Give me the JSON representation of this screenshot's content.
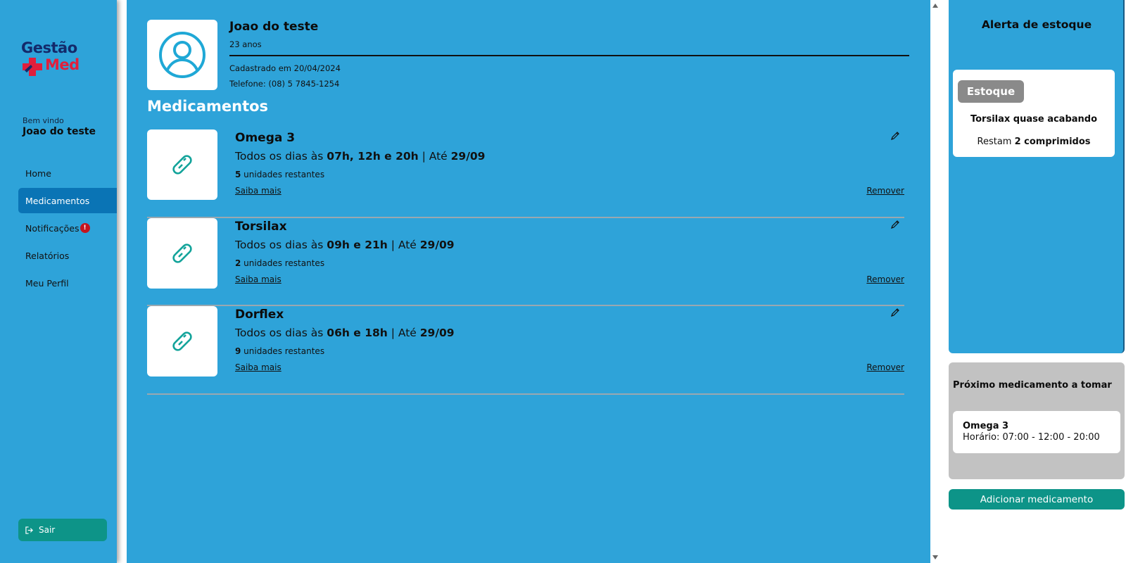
{
  "sidebar": {
    "logo": {
      "line1": "Gestão",
      "line2": "Med"
    },
    "welcome_label": "Bem vindo",
    "user_name": "Joao do teste",
    "nav": [
      {
        "label": "Home",
        "active": false
      },
      {
        "label": "Medicamentos",
        "active": true
      },
      {
        "label": "Notificações",
        "active": false,
        "badge": "!"
      },
      {
        "label": "Relatórios",
        "active": false
      },
      {
        "label": "Meu Perfil",
        "active": false
      }
    ],
    "logout_label": "Sair"
  },
  "profile": {
    "name": "Joao do teste",
    "age": "23 anos",
    "registered": "Cadastrado em 20/04/2024",
    "phone": "Telefone: (08) 5 7845-1254"
  },
  "section_title": "Medicamentos",
  "medications": [
    {
      "name": "Omega 3",
      "sched_prefix": "Todos os dias às ",
      "times": "07h, 12h e 20h",
      "until_prefix": " | Até ",
      "until": "29/09",
      "units": "5",
      "units_suffix": " unidades restantes",
      "more": "Saiba mais",
      "remove": "Remover"
    },
    {
      "name": "Torsilax",
      "sched_prefix": "Todos os dias às ",
      "times": "09h e 21h",
      "until_prefix": " | Até ",
      "until": "29/09",
      "units": "2",
      "units_suffix": " unidades restantes",
      "more": "Saiba mais",
      "remove": "Remover"
    },
    {
      "name": "Dorflex",
      "sched_prefix": "Todos os dias às ",
      "times": "06h e 18h",
      "until_prefix": " | Até ",
      "until": "29/09",
      "units": "9",
      "units_suffix": " unidades restantes",
      "more": "Saiba mais",
      "remove": "Remover"
    }
  ],
  "stock_alert": {
    "title": "Alerta de estoque",
    "tag": "Estoque",
    "message": "Torsilax quase acabando",
    "rest_prefix": "Restam ",
    "rest_value": "2 comprimidos"
  },
  "next_med": {
    "title": "Próximo medicamento a tomar",
    "name": "Omega 3",
    "time": "Horário: 07:00 - 12:00 - 20:00"
  },
  "add_button": "Adicionar medicamento",
  "colors": {
    "panel": "#2ea3d9",
    "active_nav": "#0a74b5",
    "button": "#0d9488",
    "logo_blue": "#132a6b",
    "logo_red": "#e01f3c",
    "icon_teal": "#12a39a"
  },
  "icons": [
    "user-circle-icon",
    "pill-icon",
    "pencil-icon",
    "logout-icon",
    "medical-cross-icon"
  ]
}
